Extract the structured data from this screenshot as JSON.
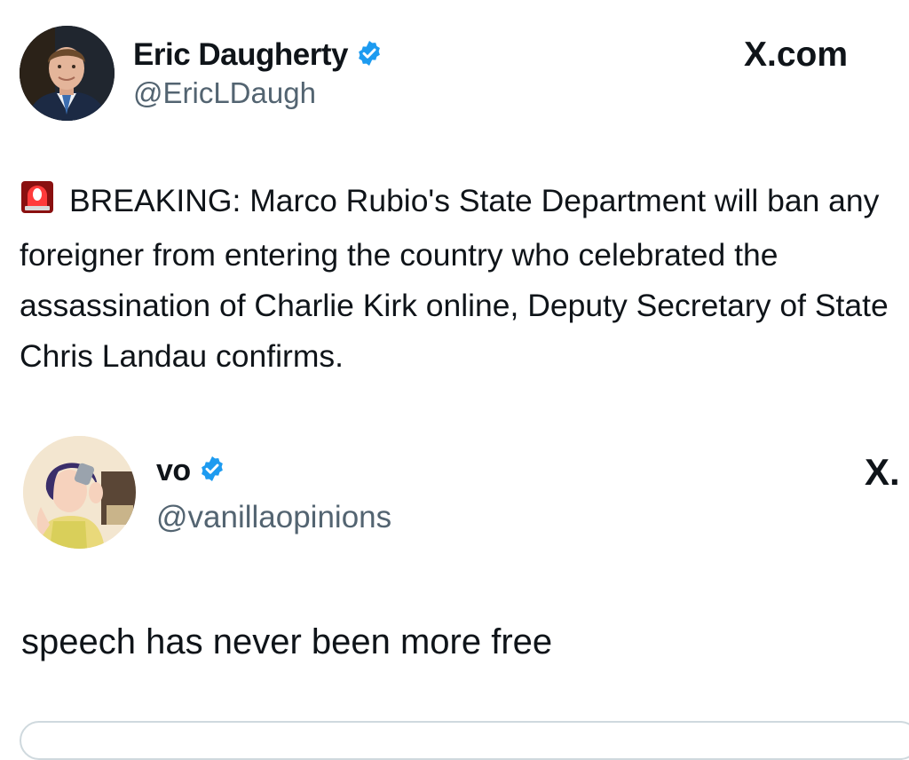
{
  "tweet1": {
    "display_name": "Eric Daugherty",
    "handle": "@EricLDaugh",
    "brand": "X.com",
    "text": "BREAKING: Marco Rubio's State Department will ban any foreigner from entering the country who celebrated the assassination of Charlie Kirk online, Deputy Secretary of State Chris Landau confirms.",
    "emoji_icon": "rotating-light-emoji",
    "verified_color": "#1d9bf0"
  },
  "tweet2": {
    "display_name": "vo",
    "handle": "@vanillaopinions",
    "brand": "X.",
    "text": "speech has never been more free",
    "verified_color": "#1d9bf0"
  }
}
